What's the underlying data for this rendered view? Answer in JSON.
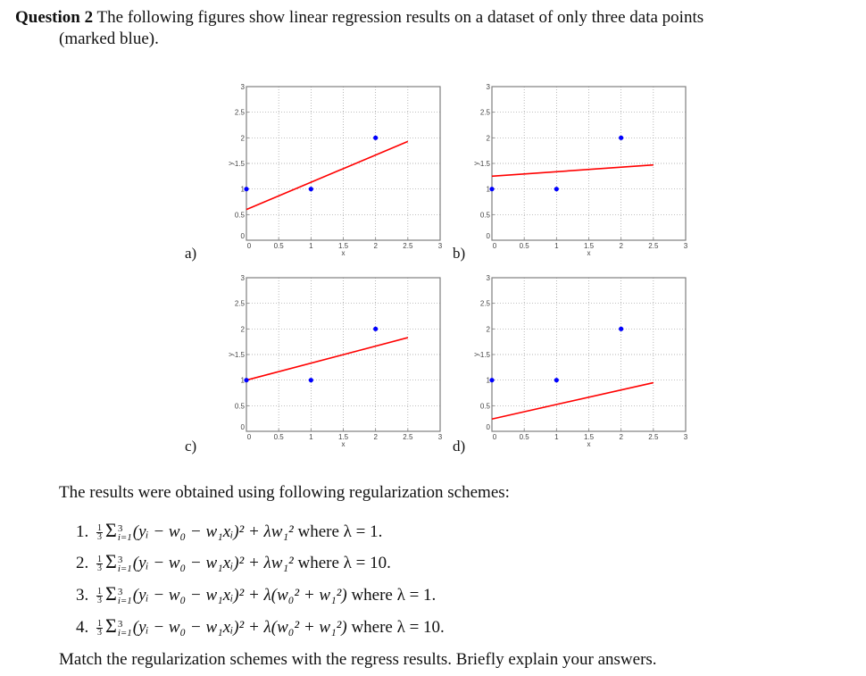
{
  "question": {
    "number_label": "Question 2",
    "text_line1": "The following figures show linear regression results on a dataset of only three data points",
    "text_line2": "(marked blue)."
  },
  "colors": {
    "data_points": "#0000ff",
    "regression_line": "#ff0000",
    "grid": "#9a9a9a",
    "axes": "#7f7f7f"
  },
  "chart_data": [
    {
      "type": "scatter",
      "panel": "a)",
      "title": "",
      "xlabel": "x",
      "ylabel": "y",
      "xlim": [
        0,
        3
      ],
      "ylim": [
        0,
        3
      ],
      "xticks": [
        "0",
        "0.5",
        "1",
        "1.5",
        "2",
        "2.5",
        "3"
      ],
      "yticks": [
        "0",
        "0.5",
        "1",
        "1.5",
        "2",
        "2.5",
        "3"
      ],
      "grid": true,
      "points": {
        "x": [
          0,
          1,
          2
        ],
        "y": [
          1,
          1,
          2
        ]
      },
      "line": {
        "x": [
          0,
          2.5
        ],
        "y": [
          0.6,
          1.93
        ]
      }
    },
    {
      "type": "scatter",
      "panel": "b)",
      "title": "",
      "xlabel": "x",
      "ylabel": "y",
      "xlim": [
        0,
        3
      ],
      "ylim": [
        0,
        3
      ],
      "xticks": [
        "0",
        "0.5",
        "1",
        "1.5",
        "2",
        "2.5",
        "3"
      ],
      "yticks": [
        "0",
        "0.5",
        "1",
        "1.5",
        "2",
        "2.5",
        "3"
      ],
      "grid": true,
      "points": {
        "x": [
          0,
          1,
          2
        ],
        "y": [
          1,
          1,
          2
        ]
      },
      "line": {
        "x": [
          0,
          2.5
        ],
        "y": [
          1.25,
          1.47
        ]
      }
    },
    {
      "type": "scatter",
      "panel": "c)",
      "title": "",
      "xlabel": "x",
      "ylabel": "y",
      "xlim": [
        0,
        3
      ],
      "ylim": [
        0,
        3
      ],
      "xticks": [
        "0",
        "0.5",
        "1",
        "1.5",
        "2",
        "2.5",
        "3"
      ],
      "yticks": [
        "0",
        "0.5",
        "1",
        "1.5",
        "2",
        "2.5",
        "3"
      ],
      "grid": true,
      "points": {
        "x": [
          0,
          1,
          2
        ],
        "y": [
          1,
          1,
          2
        ]
      },
      "line": {
        "x": [
          0,
          2.5
        ],
        "y": [
          1.0,
          1.83
        ]
      }
    },
    {
      "type": "scatter",
      "panel": "d)",
      "title": "",
      "xlabel": "x",
      "ylabel": "y",
      "xlim": [
        0,
        3
      ],
      "ylim": [
        0,
        3
      ],
      "xticks": [
        "0",
        "0.5",
        "1",
        "1.5",
        "2",
        "2.5",
        "3"
      ],
      "yticks": [
        "0",
        "0.5",
        "1",
        "1.5",
        "2",
        "2.5",
        "3"
      ],
      "grid": true,
      "points": {
        "x": [
          0,
          1,
          2
        ],
        "y": [
          1,
          1,
          2
        ]
      },
      "line": {
        "x": [
          0,
          2.5
        ],
        "y": [
          0.24,
          0.95
        ]
      }
    }
  ],
  "intro": "The results were obtained using following regularization schemes:",
  "schemes": [
    {
      "num": "1.",
      "penalty": "λw₁²",
      "lambda": "1"
    },
    {
      "num": "2.",
      "penalty": "λw₁²",
      "lambda": "10"
    },
    {
      "num": "3.",
      "penalty": "λ(w₀² + w₁²)",
      "lambda": "1"
    },
    {
      "num": "4.",
      "penalty": "λ(w₀² + w₁²)",
      "lambda": "10"
    }
  ],
  "formula_common": {
    "frac_num": "1",
    "frac_den": "3",
    "sum_upper": "3",
    "sum_lower": "i=1",
    "residual": "(yᵢ − w₀ − w₁xᵢ)²",
    "where": "where λ ="
  },
  "footer": "Match the regularization schemes with the regress results. Briefly explain your answers."
}
